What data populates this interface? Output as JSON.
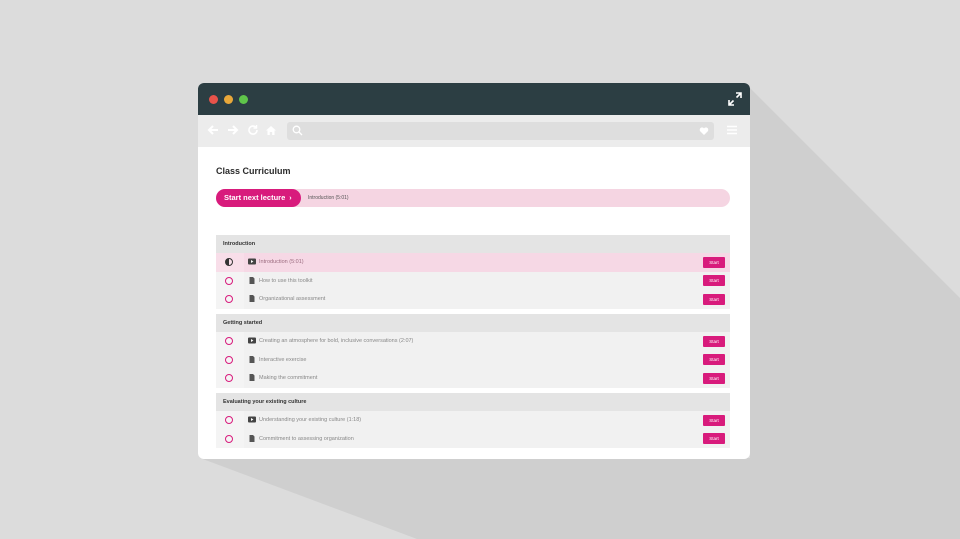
{
  "page": {
    "title": "Class Curriculum",
    "start_next_label": "Start next lecture",
    "start_next_arrow": "›",
    "current_lecture": "Introduction (5:01)"
  },
  "colors": {
    "accent": "#d81b7c",
    "titlebar": "#2c3e43",
    "active_row": "#f6d8e5",
    "background": "#dcdcdc"
  },
  "icons": {
    "back": "back-arrow-icon",
    "forward": "forward-arrow-icon",
    "reload": "reload-icon",
    "home": "home-icon",
    "search": "search-icon",
    "favorite": "heart-icon",
    "menu": "hamburger-menu-icon",
    "expand": "expand-icon",
    "video": "video-icon",
    "document": "document-icon"
  },
  "sections": [
    {
      "title": "Introduction",
      "lectures": [
        {
          "title": "Introduction (5:01)",
          "type": "video",
          "status": "in-progress",
          "button": "Start"
        },
        {
          "title": "How to use this toolkit",
          "type": "document",
          "status": "not-started",
          "button": "Start"
        },
        {
          "title": "Organizational assessment",
          "type": "document",
          "status": "not-started",
          "button": "Start"
        }
      ]
    },
    {
      "title": "Getting started",
      "lectures": [
        {
          "title": "Creating an atmosphere for bold, inclusive conversations (2:07)",
          "type": "video",
          "status": "not-started",
          "button": "Start"
        },
        {
          "title": "Interactive exercise",
          "type": "document",
          "status": "not-started",
          "button": "Start"
        },
        {
          "title": "Making the commitment",
          "type": "document",
          "status": "not-started",
          "button": "Start"
        }
      ]
    },
    {
      "title": "Evaluating your existing culture",
      "lectures": [
        {
          "title": "Understanding your existing culture (1:18)",
          "type": "video",
          "status": "not-started",
          "button": "Start"
        },
        {
          "title": "Commitment to assessing organization",
          "type": "document",
          "status": "not-started",
          "button": "Start"
        }
      ]
    }
  ]
}
